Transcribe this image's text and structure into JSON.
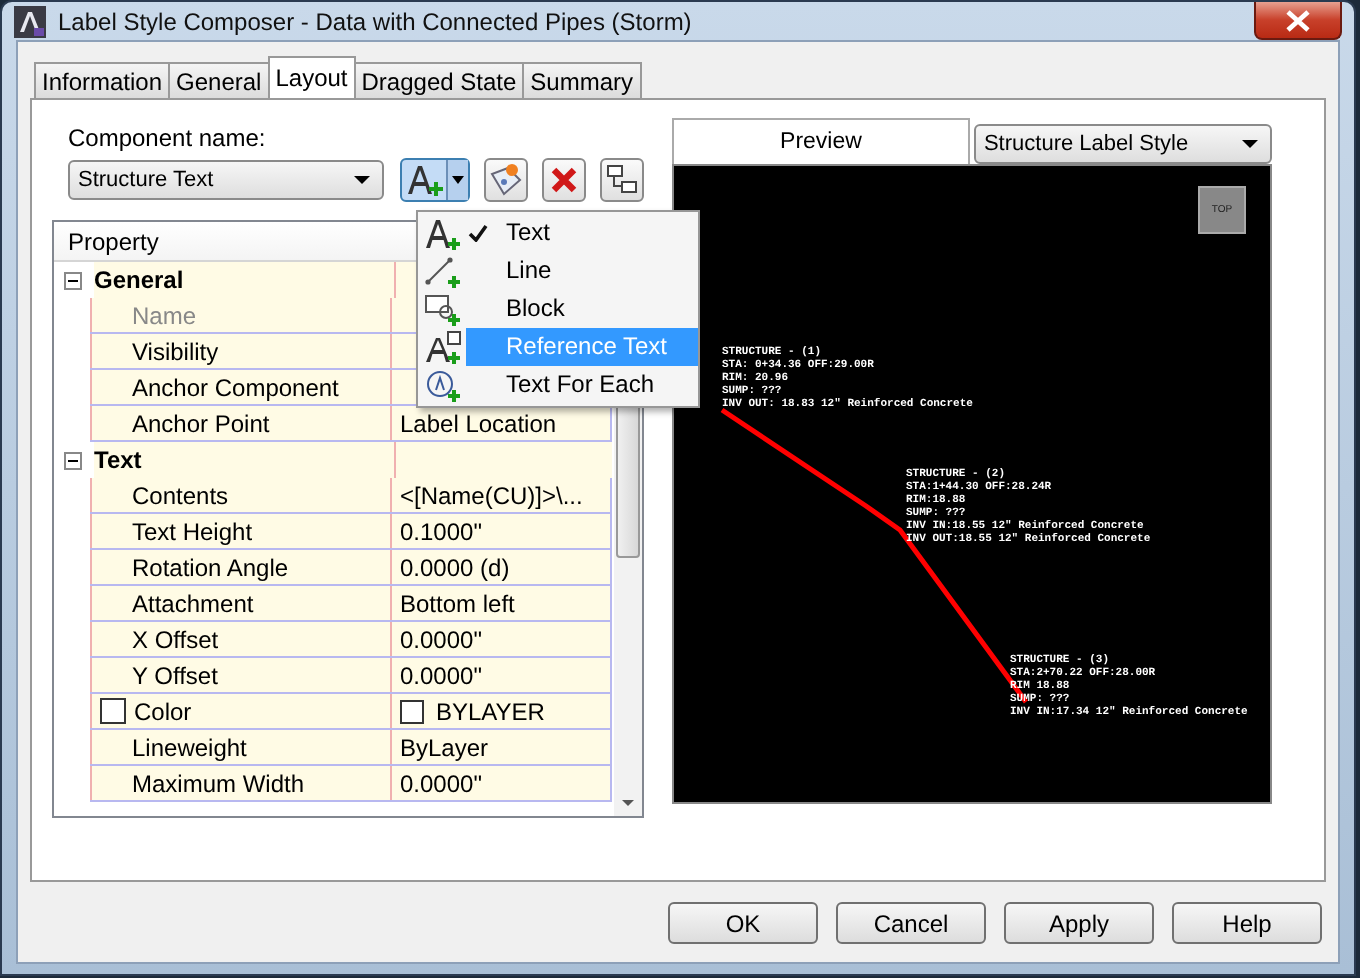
{
  "window": {
    "title": "Label Style Composer - Data with Connected Pipes (Storm)"
  },
  "tabs": [
    {
      "label": "Information",
      "selected": false
    },
    {
      "label": "General",
      "selected": false
    },
    {
      "label": "Layout",
      "selected": true
    },
    {
      "label": "Dragged State",
      "selected": false
    },
    {
      "label": "Summary",
      "selected": false
    }
  ],
  "component_name": {
    "label": "Component name:",
    "value": "Structure Text"
  },
  "toolbar": {
    "add_component_menu": {
      "expanded": true,
      "items": [
        {
          "label": "Text",
          "kind": "text",
          "checked": true,
          "selected": false
        },
        {
          "label": "Line",
          "kind": "line",
          "checked": false,
          "selected": false
        },
        {
          "label": "Block",
          "kind": "block",
          "checked": false,
          "selected": false
        },
        {
          "label": "Reference Text",
          "kind": "reference",
          "checked": false,
          "selected": true
        },
        {
          "label": "Text For Each",
          "kind": "foreach",
          "checked": false,
          "selected": false
        }
      ]
    }
  },
  "property_grid": {
    "header": "Property",
    "categories": [
      {
        "label": "General",
        "expanded": true,
        "properties": [
          {
            "name": "Name",
            "disabled": true
          },
          {
            "name": "Visibility",
            "disabled": false
          },
          {
            "name": "Anchor Component",
            "disabled": false
          },
          {
            "name": "Anchor Point",
            "value": "Label Location",
            "disabled": false
          }
        ]
      },
      {
        "label": "Text",
        "expanded": true,
        "properties": [
          {
            "name": "Contents",
            "value": "<[Name(CU)]>\\...",
            "disabled": false
          },
          {
            "name": "Text Height",
            "value": "0.1000\"",
            "disabled": false
          },
          {
            "name": "Rotation Angle",
            "value": "0.0000 (d)",
            "disabled": false
          },
          {
            "name": "Attachment",
            "value": "Bottom left",
            "disabled": false
          },
          {
            "name": "X Offset",
            "value": "0.0000\"",
            "disabled": false
          },
          {
            "name": "Y Offset",
            "value": "0.0000\"",
            "disabled": false
          },
          {
            "name": "Color",
            "value": "BYLAYER",
            "kind": "color",
            "checked": false,
            "disabled": false
          },
          {
            "name": "Lineweight",
            "value": "ByLayer",
            "disabled": false
          },
          {
            "name": "Maximum Width",
            "value": "0.0000\"",
            "disabled": false
          }
        ]
      }
    ]
  },
  "preview": {
    "tab": "Preview",
    "style": "Structure Label Style",
    "view_cube": "TOP",
    "labels": [
      {
        "lines": [
          "STRUCTURE - (1)",
          "STA: 0+34.36 OFF:29.00R",
          "RIM: 20.96",
          "SUMP: ???",
          "INV OUT: 18.83 12\" Reinforced Concrete"
        ]
      },
      {
        "lines": [
          "STRUCTURE - (2)",
          "STA:1+44.30 OFF:28.24R",
          "RIM:18.88",
          "SUMP: ???",
          "INV IN:18.55 12\" Reinforced Concrete",
          "INV OUT:18.55 12\" Reinforced Concrete"
        ]
      },
      {
        "lines": [
          "STRUCTURE - (3)",
          "STA:2+70.22 OFF:28.00R",
          "RIM 18.88",
          "SUMP: ???",
          "INV IN:17.34 12\" Reinforced Concrete"
        ]
      }
    ]
  },
  "buttons": [
    "OK",
    "Cancel",
    "Apply",
    "Help"
  ]
}
